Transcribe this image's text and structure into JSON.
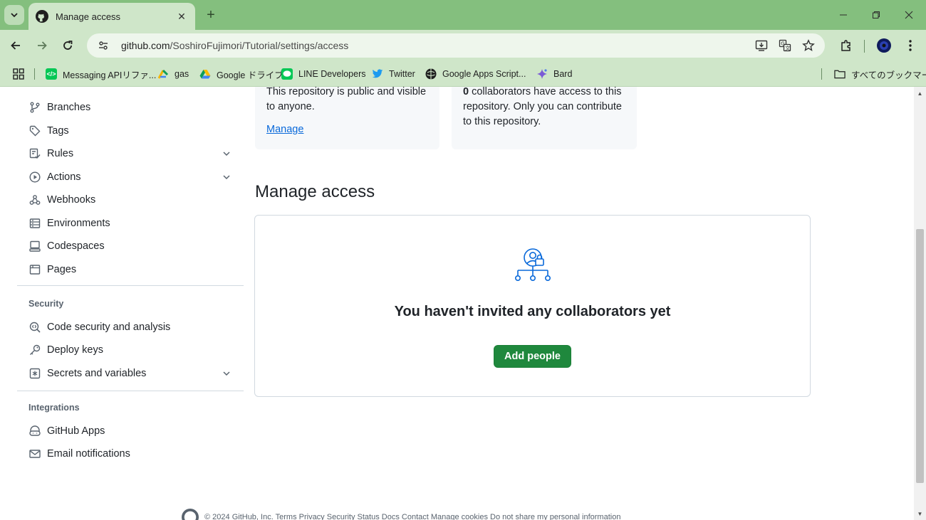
{
  "browser": {
    "tab_title": "Manage access",
    "url_host": "github.com",
    "url_path": "/SoshiroFujimori/Tutorial/settings/access",
    "new_tab_label": "+",
    "bookmarks": [
      {
        "label": "Messaging APIリファ...",
        "icon": "line-api-icon"
      },
      {
        "label": "gas",
        "icon": "gas-icon"
      },
      {
        "label": "Google ドライブ",
        "icon": "google-drive-icon"
      },
      {
        "label": "LINE Developers",
        "icon": "line-icon"
      },
      {
        "label": "Twitter",
        "icon": "twitter-icon"
      },
      {
        "label": "Google Apps Script...",
        "icon": "apps-script-icon"
      },
      {
        "label": "Bard",
        "icon": "bard-icon"
      }
    ],
    "all_bookmarks_label": "すべてのブックマーク"
  },
  "sidebar": {
    "items": [
      {
        "label": "Branches",
        "icon": "branch-icon"
      },
      {
        "label": "Tags",
        "icon": "tag-icon"
      },
      {
        "label": "Rules",
        "icon": "rules-icon",
        "expandable": true
      },
      {
        "label": "Actions",
        "icon": "actions-icon",
        "expandable": true
      },
      {
        "label": "Webhooks",
        "icon": "webhook-icon"
      },
      {
        "label": "Environments",
        "icon": "environments-icon"
      },
      {
        "label": "Codespaces",
        "icon": "codespaces-icon"
      },
      {
        "label": "Pages",
        "icon": "pages-icon"
      }
    ],
    "security_heading": "Security",
    "security_items": [
      {
        "label": "Code security and analysis",
        "icon": "codescan-icon"
      },
      {
        "label": "Deploy keys",
        "icon": "key-icon"
      },
      {
        "label": "Secrets and variables",
        "icon": "secret-icon",
        "expandable": true
      }
    ],
    "integrations_heading": "Integrations",
    "integrations_items": [
      {
        "label": "GitHub Apps",
        "icon": "github-apps-icon"
      },
      {
        "label": "Email notifications",
        "icon": "mail-icon"
      }
    ]
  },
  "visibility_card": {
    "text": "This repository is public and visible to anyone.",
    "link": "Manage"
  },
  "access_card": {
    "count": "0",
    "text": " collaborators have access to this repository. Only you can contribute to this repository."
  },
  "main": {
    "heading": "Manage access",
    "empty_title": "You haven't invited any collaborators yet",
    "add_button": "Add people"
  },
  "footer": {
    "text": "© 2024 GitHub, Inc.   Terms   Privacy   Security   Status   Docs   Contact   Manage cookies   Do not share my personal information"
  },
  "colors": {
    "tabstrip": "#84bf7e",
    "toolbar": "#cfe6c9",
    "primary_button": "#1f883d",
    "link": "#0969da"
  }
}
